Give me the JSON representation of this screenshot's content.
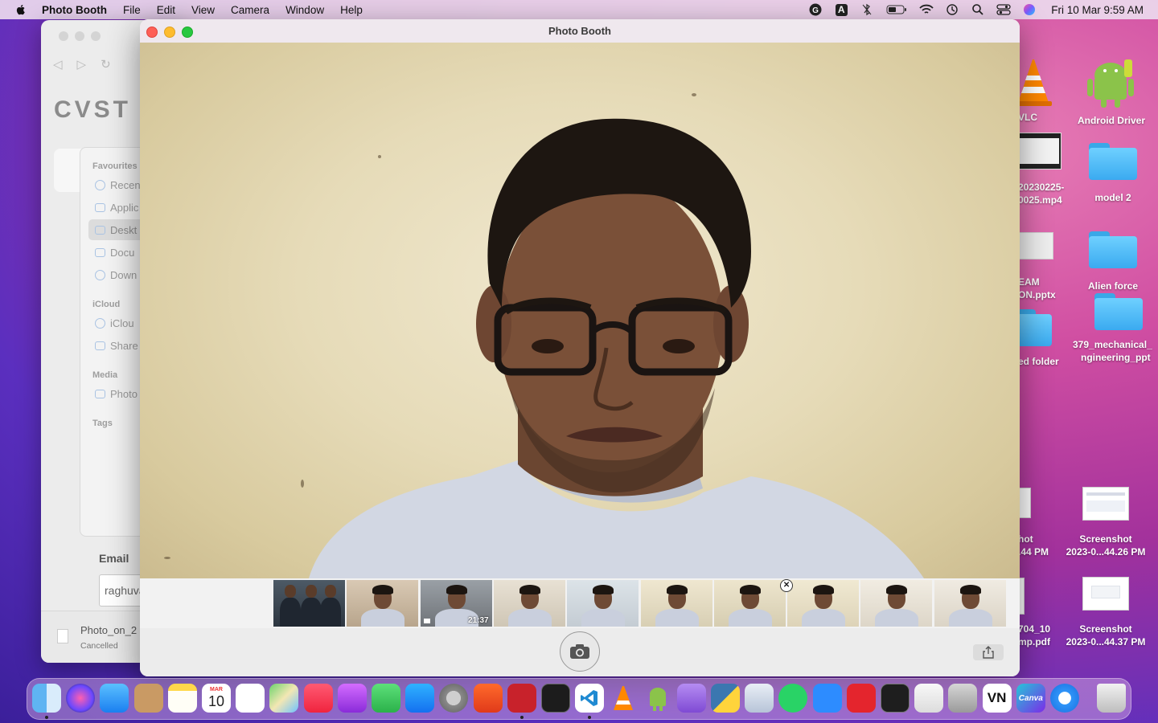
{
  "menubar": {
    "app_name": "Photo Booth",
    "menus": [
      "File",
      "Edit",
      "View",
      "Camera",
      "Window",
      "Help"
    ],
    "status_icons": [
      "grammarly-icon",
      "input-source-icon",
      "bluetooth-icon",
      "battery-icon",
      "wifi-icon",
      "time-machine-icon",
      "spotlight-icon",
      "control-center-icon",
      "siri-icon"
    ],
    "input_source_label": "A",
    "clock": "Fri 10 Mar  9:59 AM"
  },
  "background_window": {
    "logo_text": "CVST",
    "sidebar": {
      "favourites_heading": "Favourites",
      "favourites": [
        "Recen",
        "Applic",
        "Deskt",
        "Docu",
        "Down"
      ],
      "icloud_heading": "iCloud",
      "icloud": [
        "iClou",
        "Share"
      ],
      "media_heading": "Media",
      "media": [
        "Photo"
      ],
      "tags_heading": "Tags"
    },
    "email_label": "Email",
    "email_value": "raghuva",
    "download": {
      "filename": "Photo_on_2",
      "status": "Cancelled"
    }
  },
  "photo_booth": {
    "title": "Photo Booth",
    "selected_thumbnail": 7,
    "thumbnails": [
      {
        "kind": "group-photo"
      },
      {
        "kind": "photo"
      },
      {
        "kind": "video",
        "duration": "21:37"
      },
      {
        "kind": "photo"
      },
      {
        "kind": "photo"
      },
      {
        "kind": "photo"
      },
      {
        "kind": "photo"
      },
      {
        "kind": "photo",
        "selected": true
      },
      {
        "kind": "photo"
      },
      {
        "kind": "photo"
      }
    ],
    "remove_label": "✕",
    "shutter_icon": "camera-icon",
    "share_icon": "share-icon"
  },
  "desktop_icons": [
    {
      "label": "VLC",
      "icon": "vlc-icon"
    },
    {
      "label": "Android Driver",
      "icon": "android-icon"
    },
    {
      "label": "20230225-",
      "label2": "0025.mp4",
      "icon": "video-file-icon"
    },
    {
      "label": "model 2",
      "icon": "folder-icon"
    },
    {
      "label": "EAM",
      "label2": "ON.pptx",
      "icon": "pptx-file-icon"
    },
    {
      "label": "Alien force",
      "icon": "folder-icon"
    },
    {
      "label": "ed folder",
      "icon": "folder-icon"
    },
    {
      "label": "379_mechanical_",
      "label2": "ngineering_ppt",
      "icon": "folder-icon"
    },
    {
      "label": "hot",
      "label2": ".44 PM",
      "icon": "screenshot-file-icon"
    },
    {
      "label": "Screenshot",
      "label2": "2023-0...44.26 PM",
      "icon": "screenshot-file-icon"
    },
    {
      "label": "704_10",
      "label2": "mp.pdf",
      "icon": "pdf-file-icon"
    },
    {
      "label": "Screenshot",
      "label2": "2023-0...44.37 PM",
      "icon": "screenshot-file-icon"
    }
  ],
  "dock": {
    "calendar_month": "MAR",
    "calendar_day": "10",
    "vn_label": "VN",
    "canva_label": "Canva",
    "apps": [
      "finder-icon",
      "siri-icon",
      "mail-icon",
      "contacts-icon",
      "notes-icon",
      "calendar-icon",
      "reminders-icon",
      "maps-icon",
      "music-icon",
      "podcasts-icon",
      "facetime-icon",
      "app-store-icon",
      "system-settings-icon",
      "brave-icon",
      "photo-booth-icon",
      "activity-monitor-icon",
      "vscode-icon",
      "vlc-icon",
      "android-icon",
      "github-icon",
      "python-icon",
      "preview-icon",
      "whatsapp-icon",
      "zoom-icon",
      "wps-icon",
      "terminal-icon",
      "textedit-icon",
      "unity-icon",
      "vn-icon",
      "canva-icon",
      "safari-icon",
      "trash-icon"
    ]
  }
}
